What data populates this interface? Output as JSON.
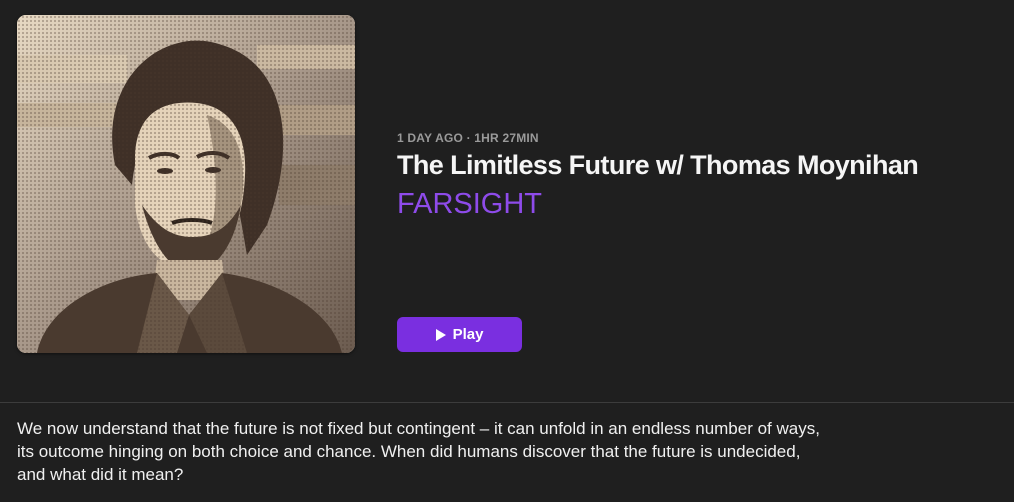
{
  "episode": {
    "meta": "1 DAY AGO · 1HR 27MIN",
    "title": "The Limitless Future w/ Thomas Moynihan",
    "show": "FARSIGHT",
    "description": "We now understand that the future is not fixed but contingent – it can unfold in an endless number of ways, its outcome hinging on both choice and chance. When did humans discover that the future is undecided, and what did it mean?"
  },
  "play_button": {
    "label": "Play",
    "icon": "play-icon"
  },
  "artwork": {
    "icon": "episode-artwork",
    "palette": [
      "#ede0cc",
      "#4a3a2f"
    ]
  },
  "colors": {
    "background": "#1f1f1f",
    "accent": "#7a2fe0",
    "show_link": "#8e4bea",
    "meta_text": "#9a9a9a"
  }
}
